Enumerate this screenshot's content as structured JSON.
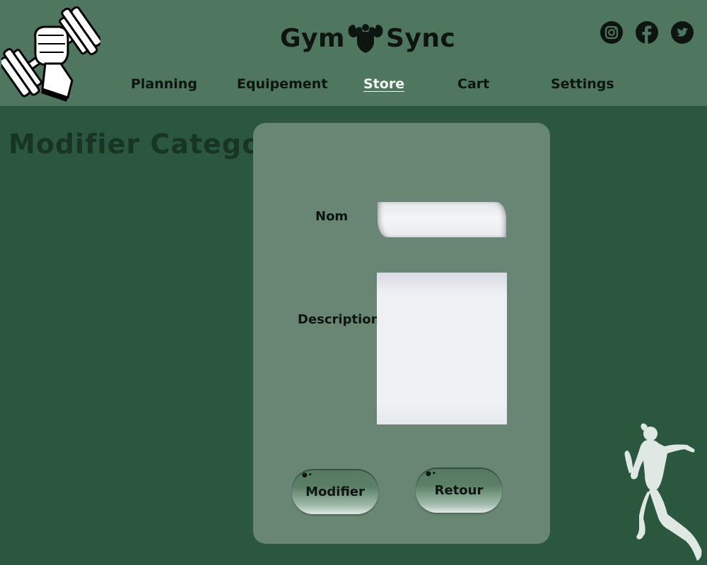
{
  "brand": {
    "left": "Gym",
    "right": "Sync"
  },
  "icons": {
    "logo": "dumbbell-fist-icon",
    "brand": "bodybuilder-icon",
    "socials": [
      "instagram-icon",
      "facebook-icon",
      "twitter-icon"
    ],
    "decoration": "runner-silhouette-icon"
  },
  "nav": {
    "items": [
      {
        "label": "Planning"
      },
      {
        "label": "Equipement"
      },
      {
        "label": "Store",
        "active": true
      },
      {
        "label": "Cart"
      },
      {
        "label": "Settings"
      }
    ]
  },
  "page": {
    "title": "Modifier Categorie"
  },
  "form": {
    "nom_label": "Nom",
    "nom_value": "",
    "description_label": "Description",
    "description_value": "",
    "modify_label": "Modifier",
    "back_label": "Retour"
  },
  "colors": {
    "background": "#2b573f",
    "header": "#4f765e",
    "card": "#698675",
    "title": "#183424",
    "active_nav": "#f4f6f4"
  }
}
